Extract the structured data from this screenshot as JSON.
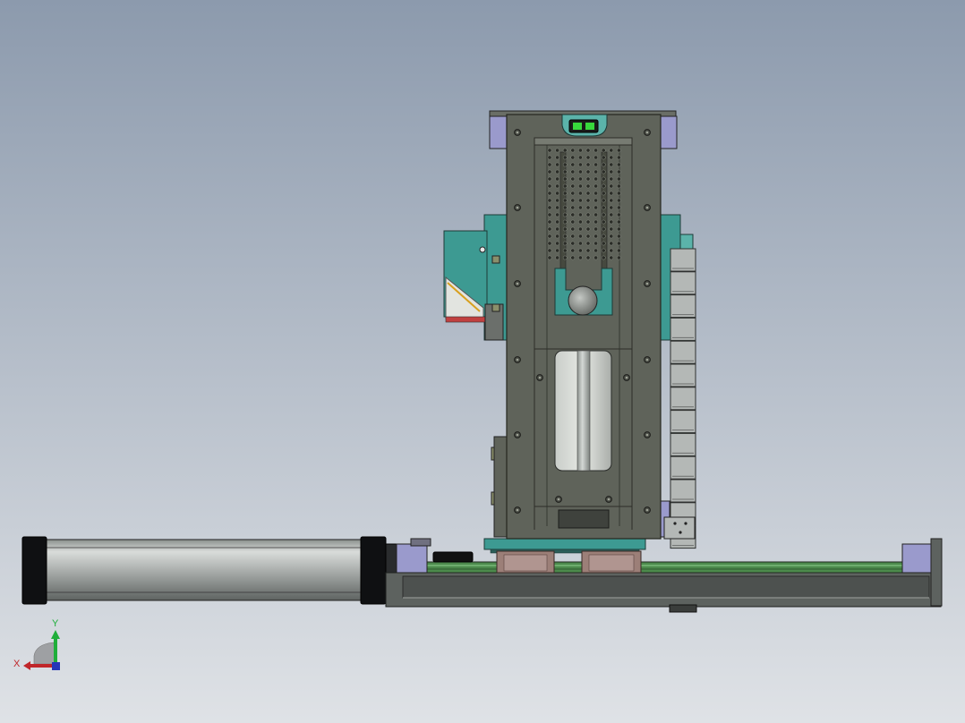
{
  "view": {
    "background_top": "#8c9aad",
    "background_bottom": "#dfe2e6"
  },
  "triad": {
    "x_label": "X",
    "y_label": "Y",
    "x_color": "#c0262a",
    "y_color": "#1fae3a",
    "z_color": "#2636b8"
  },
  "colors": {
    "plate_dark": "#5f635a",
    "plate_edge": "#25271f",
    "teal": "#3d9a92",
    "teal_light": "#5bb3aa",
    "lavender": "#9a9acc",
    "rail_green": "#4c8a4c",
    "cylinder_light": "#c9cdcb",
    "cylinder_dark": "#6f7472",
    "block_brown": "#9c7f78",
    "sensor_green": "#38d83c",
    "chain_grey": "#b4b8b6"
  }
}
